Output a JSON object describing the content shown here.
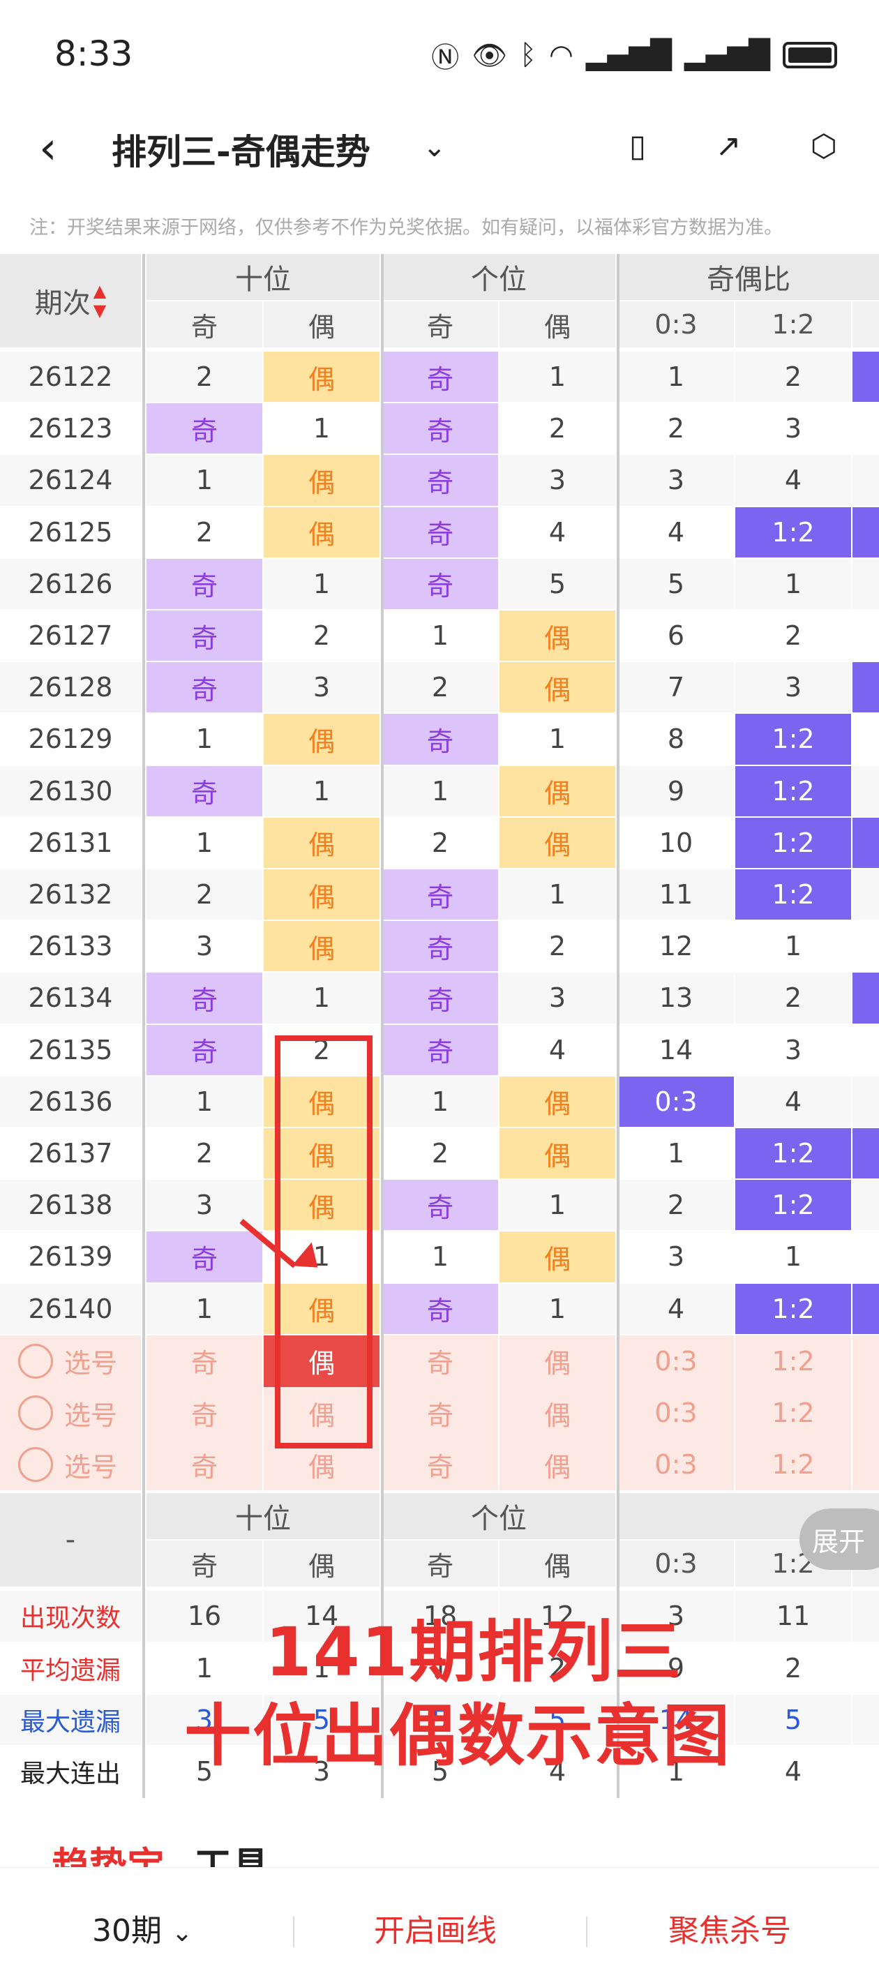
{
  "status": {
    "time": "8:33",
    "icons": [
      "nfc-icon",
      "eye-icon",
      "bluetooth-icon",
      "wifi-icon",
      "signal-icon",
      "signal-icon",
      "battery-icon"
    ]
  },
  "nav": {
    "title": "排列三-奇偶走势"
  },
  "notice": "注：开奖结果来源于网络，仅供参考不作为兑奖依据。如有疑问，以福体彩官方数据为准。",
  "header": {
    "period": "期次",
    "group_tens": "十位",
    "group_units": "个位",
    "group_ratio": "奇偶比",
    "odd": "奇",
    "even": "偶",
    "r03": "0:3",
    "r12": "1:2"
  },
  "rows": [
    {
      "p": "26122",
      "t": [
        "2",
        "偶"
      ],
      "u": [
        "奇",
        "1"
      ],
      "r": [
        "1",
        "2"
      ]
    },
    {
      "p": "26123",
      "t": [
        "奇",
        "1"
      ],
      "u": [
        "奇",
        "2"
      ],
      "r": [
        "2",
        "3"
      ]
    },
    {
      "p": "26124",
      "t": [
        "1",
        "偶"
      ],
      "u": [
        "奇",
        "3"
      ],
      "r": [
        "3",
        "4"
      ]
    },
    {
      "p": "26125",
      "t": [
        "2",
        "偶"
      ],
      "u": [
        "奇",
        "4"
      ],
      "r": [
        "4",
        "1:2"
      ]
    },
    {
      "p": "26126",
      "t": [
        "奇",
        "1"
      ],
      "u": [
        "奇",
        "5"
      ],
      "r": [
        "5",
        "1"
      ]
    },
    {
      "p": "26127",
      "t": [
        "奇",
        "2"
      ],
      "u": [
        "1",
        "偶"
      ],
      "r": [
        "6",
        "2"
      ]
    },
    {
      "p": "26128",
      "t": [
        "奇",
        "3"
      ],
      "u": [
        "2",
        "偶"
      ],
      "r": [
        "7",
        "3"
      ]
    },
    {
      "p": "26129",
      "t": [
        "1",
        "偶"
      ],
      "u": [
        "奇",
        "1"
      ],
      "r": [
        "8",
        "1:2"
      ]
    },
    {
      "p": "26130",
      "t": [
        "奇",
        "1"
      ],
      "u": [
        "1",
        "偶"
      ],
      "r": [
        "9",
        "1:2"
      ]
    },
    {
      "p": "26131",
      "t": [
        "1",
        "偶"
      ],
      "u": [
        "2",
        "偶"
      ],
      "r": [
        "10",
        "1:2"
      ]
    },
    {
      "p": "26132",
      "t": [
        "2",
        "偶"
      ],
      "u": [
        "奇",
        "1"
      ],
      "r": [
        "11",
        "1:2"
      ]
    },
    {
      "p": "26133",
      "t": [
        "3",
        "偶"
      ],
      "u": [
        "奇",
        "2"
      ],
      "r": [
        "12",
        "1"
      ]
    },
    {
      "p": "26134",
      "t": [
        "奇",
        "1"
      ],
      "u": [
        "奇",
        "3"
      ],
      "r": [
        "13",
        "2"
      ]
    },
    {
      "p": "26135",
      "t": [
        "奇",
        "2"
      ],
      "u": [
        "奇",
        "4"
      ],
      "r": [
        "14",
        "3"
      ]
    },
    {
      "p": "26136",
      "t": [
        "1",
        "偶"
      ],
      "u": [
        "1",
        "偶"
      ],
      "r": [
        "0:3",
        "4"
      ]
    },
    {
      "p": "26137",
      "t": [
        "2",
        "偶"
      ],
      "u": [
        "2",
        "偶"
      ],
      "r": [
        "1",
        "1:2"
      ]
    },
    {
      "p": "26138",
      "t": [
        "3",
        "偶"
      ],
      "u": [
        "奇",
        "1"
      ],
      "r": [
        "2",
        "1:2"
      ]
    },
    {
      "p": "26139",
      "t": [
        "奇",
        "1"
      ],
      "u": [
        "1",
        "偶"
      ],
      "r": [
        "3",
        "1"
      ]
    },
    {
      "p": "26140",
      "t": [
        "1",
        "偶"
      ],
      "u": [
        "奇",
        "1"
      ],
      "r": [
        "4",
        "1:2"
      ]
    }
  ],
  "select_label": "选号",
  "summary": {
    "dash": "-",
    "expand": "展开",
    "rows": [
      {
        "label": "出现次数",
        "color": "#e8302e",
        "v": [
          "16",
          "14",
          "18",
          "12",
          "3",
          "11"
        ]
      },
      {
        "label": "平均遗漏",
        "color": "#e8302e",
        "v": [
          "1",
          "1",
          "1",
          "2",
          "9",
          "2"
        ]
      },
      {
        "label": "最大遗漏",
        "color": "#2a5ad6",
        "v": [
          "3",
          "5",
          "5",
          "5",
          "14",
          "5"
        ]
      },
      {
        "label": "最大连出",
        "color": "#222",
        "v": [
          "5",
          "3",
          "5",
          "4",
          "1",
          "4"
        ]
      }
    ]
  },
  "overlay": {
    "line1": "141期排列三",
    "line2": "十位出偶数示意图"
  },
  "card": {
    "brand": "趋势宝",
    "tool": "工具"
  },
  "tabbar": {
    "period": "30期",
    "draw": "开启画线",
    "focus": "聚焦杀号"
  }
}
